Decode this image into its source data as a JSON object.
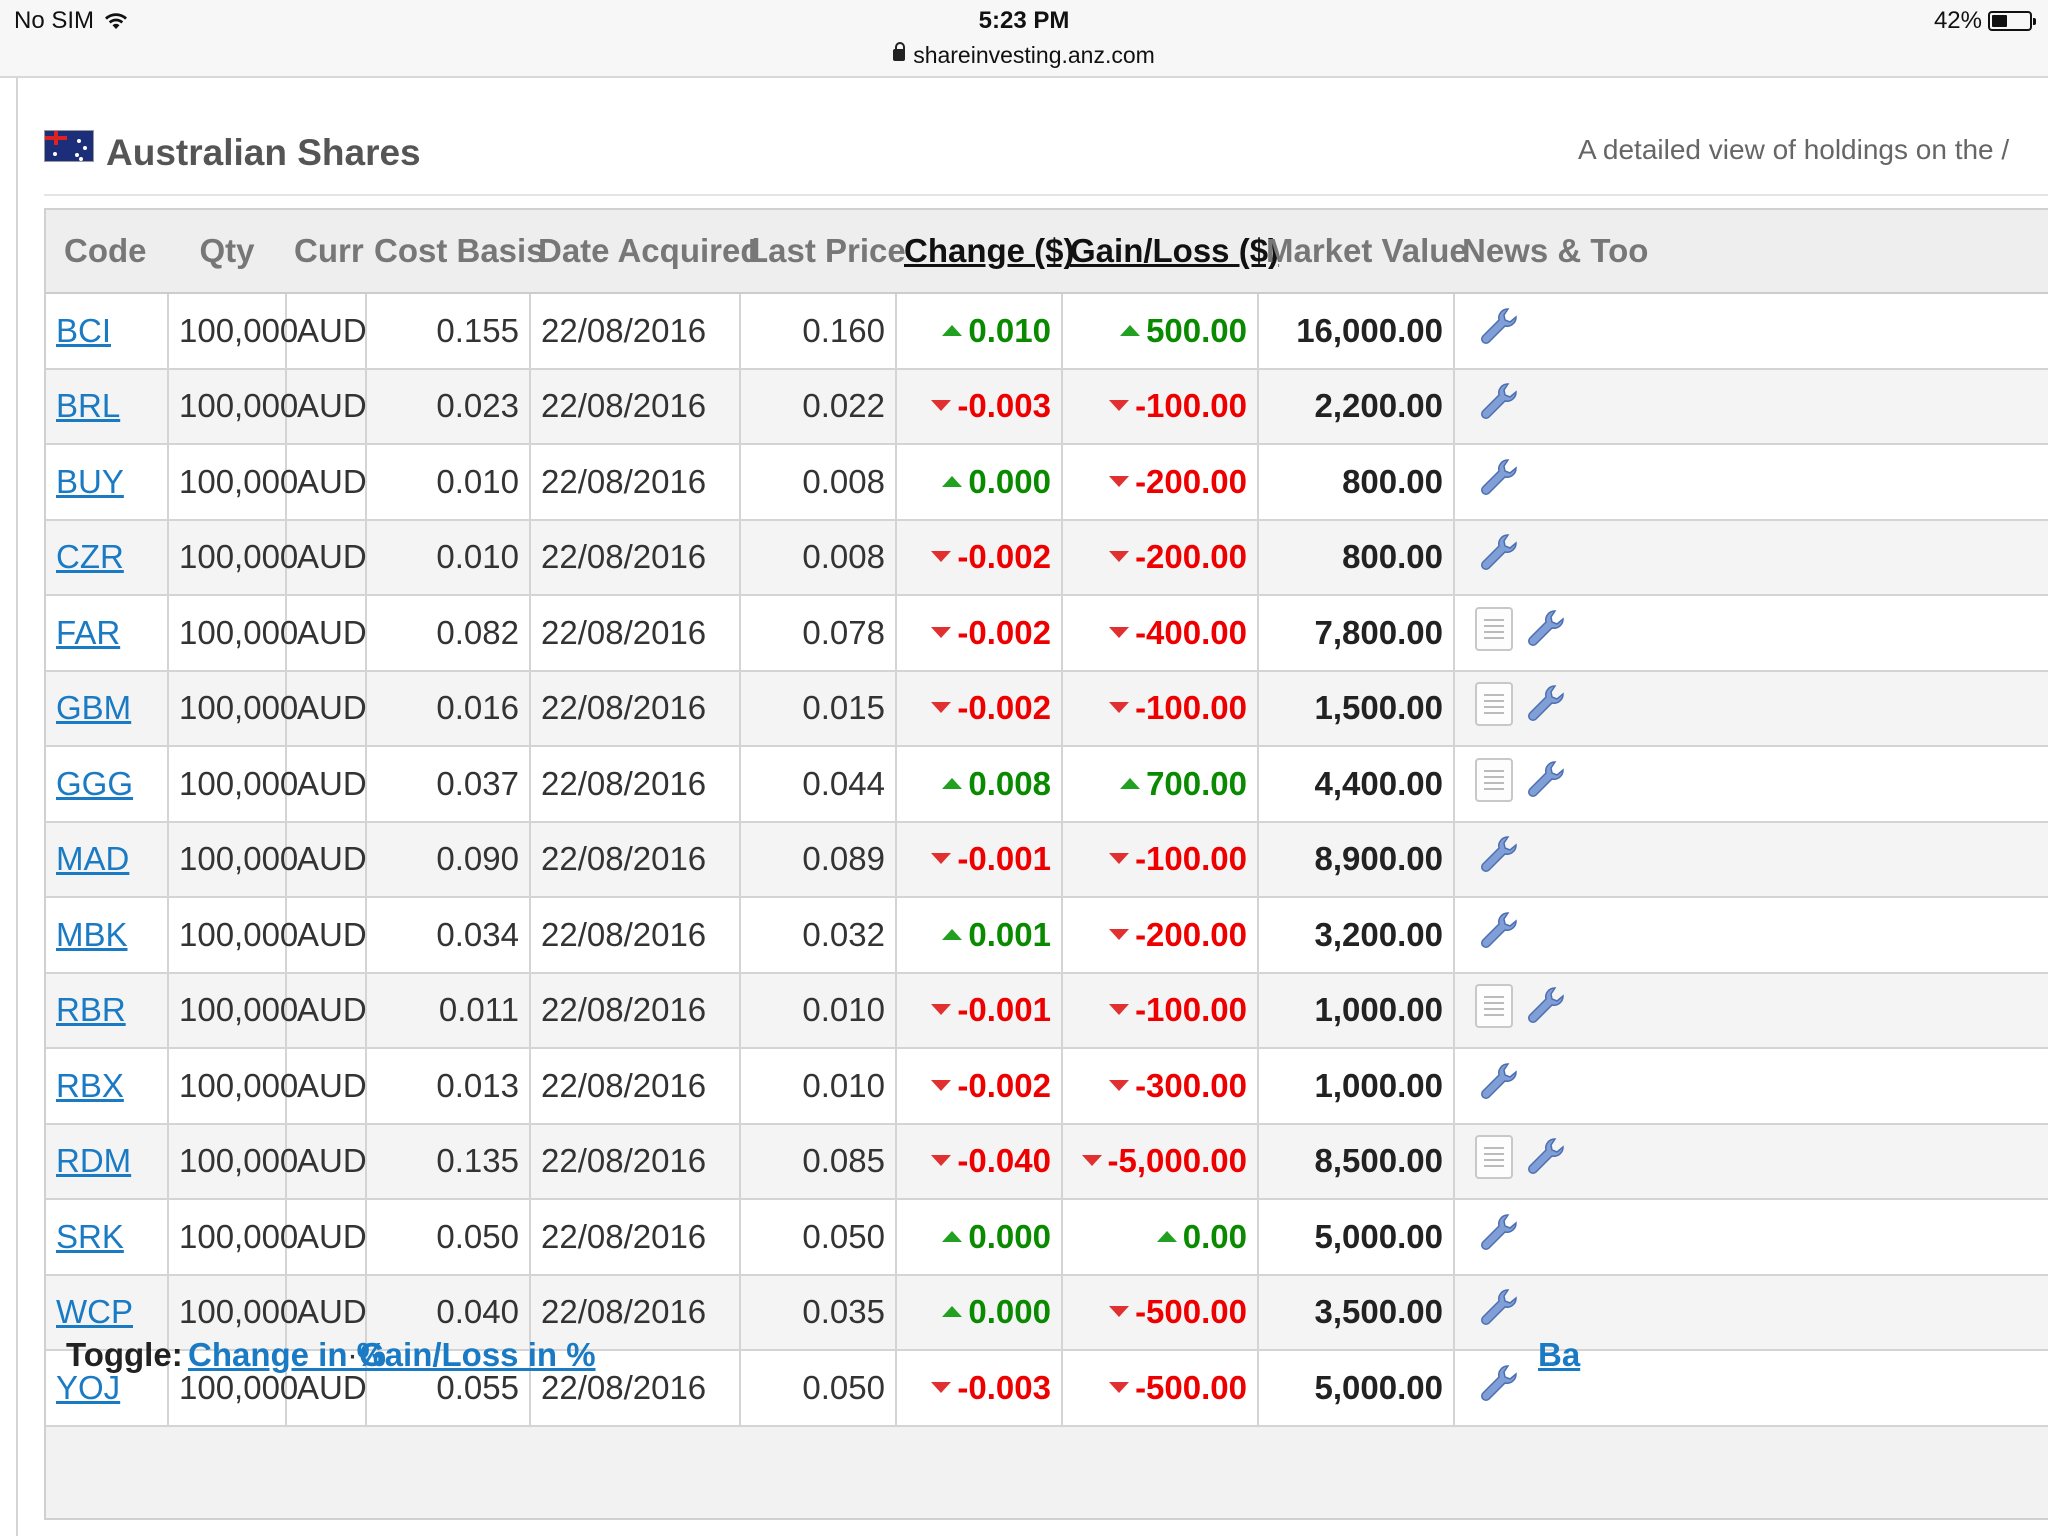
{
  "status_bar": {
    "carrier": "No SIM",
    "time": "5:23 PM",
    "url": "shareinvesting.anz.com",
    "battery": "42%",
    "battery_level": 0.42
  },
  "header": {
    "title": "Australian Shares",
    "subtitle": "A detailed view of holdings on the /"
  },
  "columns": [
    "Code",
    "Qty",
    "Curr",
    "Cost Basis",
    "Date Acquired",
    "Last Price",
    "Change ($)",
    "Gain/Loss ($)",
    "Market Value",
    "News & Too"
  ],
  "rows": [
    {
      "code": "BCI",
      "qty": "100,000",
      "curr": "AUD",
      "cost": "0.155",
      "date": "22/08/2016",
      "last": "0.160",
      "change": "0.010",
      "change_dir": "up",
      "gain": "500.00",
      "gain_dir": "up",
      "value": "16,000.00",
      "news": false
    },
    {
      "code": "BRL",
      "qty": "100,000",
      "curr": "AUD",
      "cost": "0.023",
      "date": "22/08/2016",
      "last": "0.022",
      "change": "-0.003",
      "change_dir": "down",
      "gain": "-100.00",
      "gain_dir": "down",
      "value": "2,200.00",
      "news": false
    },
    {
      "code": "BUY",
      "qty": "100,000",
      "curr": "AUD",
      "cost": "0.010",
      "date": "22/08/2016",
      "last": "0.008",
      "change": "0.000",
      "change_dir": "up",
      "gain": "-200.00",
      "gain_dir": "down",
      "value": "800.00",
      "news": false
    },
    {
      "code": "CZR",
      "qty": "100,000",
      "curr": "AUD",
      "cost": "0.010",
      "date": "22/08/2016",
      "last": "0.008",
      "change": "-0.002",
      "change_dir": "down",
      "gain": "-200.00",
      "gain_dir": "down",
      "value": "800.00",
      "news": false
    },
    {
      "code": "FAR",
      "qty": "100,000",
      "curr": "AUD",
      "cost": "0.082",
      "date": "22/08/2016",
      "last": "0.078",
      "change": "-0.002",
      "change_dir": "down",
      "gain": "-400.00",
      "gain_dir": "down",
      "value": "7,800.00",
      "news": true
    },
    {
      "code": "GBM",
      "qty": "100,000",
      "curr": "AUD",
      "cost": "0.016",
      "date": "22/08/2016",
      "last": "0.015",
      "change": "-0.002",
      "change_dir": "down",
      "gain": "-100.00",
      "gain_dir": "down",
      "value": "1,500.00",
      "news": true
    },
    {
      "code": "GGG",
      "qty": "100,000",
      "curr": "AUD",
      "cost": "0.037",
      "date": "22/08/2016",
      "last": "0.044",
      "change": "0.008",
      "change_dir": "up",
      "gain": "700.00",
      "gain_dir": "up",
      "value": "4,400.00",
      "news": true
    },
    {
      "code": "MAD",
      "qty": "100,000",
      "curr": "AUD",
      "cost": "0.090",
      "date": "22/08/2016",
      "last": "0.089",
      "change": "-0.001",
      "change_dir": "down",
      "gain": "-100.00",
      "gain_dir": "down",
      "value": "8,900.00",
      "news": false
    },
    {
      "code": "MBK",
      "qty": "100,000",
      "curr": "AUD",
      "cost": "0.034",
      "date": "22/08/2016",
      "last": "0.032",
      "change": "0.001",
      "change_dir": "up",
      "gain": "-200.00",
      "gain_dir": "down",
      "value": "3,200.00",
      "news": false
    },
    {
      "code": "RBR",
      "qty": "100,000",
      "curr": "AUD",
      "cost": "0.011",
      "date": "22/08/2016",
      "last": "0.010",
      "change": "-0.001",
      "change_dir": "down",
      "gain": "-100.00",
      "gain_dir": "down",
      "value": "1,000.00",
      "news": true
    },
    {
      "code": "RBX",
      "qty": "100,000",
      "curr": "AUD",
      "cost": "0.013",
      "date": "22/08/2016",
      "last": "0.010",
      "change": "-0.002",
      "change_dir": "down",
      "gain": "-300.00",
      "gain_dir": "down",
      "value": "1,000.00",
      "news": false
    },
    {
      "code": "RDM",
      "qty": "100,000",
      "curr": "AUD",
      "cost": "0.135",
      "date": "22/08/2016",
      "last": "0.085",
      "change": "-0.040",
      "change_dir": "down",
      "gain": "-5,000.00",
      "gain_dir": "down",
      "value": "8,500.00",
      "news": true
    },
    {
      "code": "SRK",
      "qty": "100,000",
      "curr": "AUD",
      "cost": "0.050",
      "date": "22/08/2016",
      "last": "0.050",
      "change": "0.000",
      "change_dir": "up",
      "gain": "0.00",
      "gain_dir": "up",
      "value": "5,000.00",
      "news": false
    },
    {
      "code": "WCP",
      "qty": "100,000",
      "curr": "AUD",
      "cost": "0.040",
      "date": "22/08/2016",
      "last": "0.035",
      "change": "0.000",
      "change_dir": "up",
      "gain": "-500.00",
      "gain_dir": "down",
      "value": "3,500.00",
      "news": false
    },
    {
      "code": "YOJ",
      "qty": "100,000",
      "curr": "AUD",
      "cost": "0.055",
      "date": "22/08/2016",
      "last": "0.050",
      "change": "-0.003",
      "change_dir": "down",
      "gain": "-500.00",
      "gain_dir": "down",
      "value": "5,000.00",
      "news": false
    }
  ],
  "footer": {
    "toggle_label": "Toggle:",
    "links": [
      "Change in %",
      "Gain/Loss in %"
    ],
    "separator": "·",
    "right_link": "Ba"
  },
  "colors": {
    "up": "#0a8a00",
    "down": "#e00000",
    "link": "#1a7ac4"
  },
  "icons": {
    "tools": "wrench-icon",
    "news": "document-icon"
  }
}
